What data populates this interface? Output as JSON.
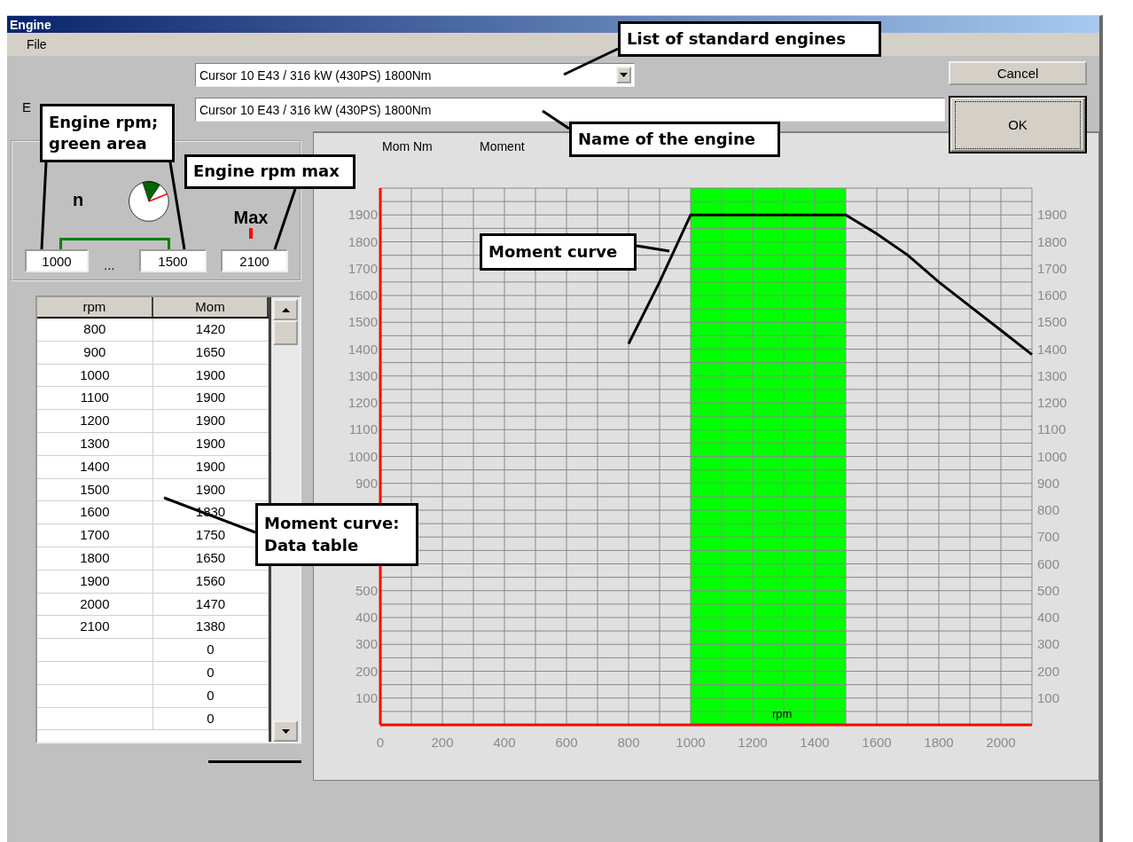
{
  "window": {
    "title": "Engine"
  },
  "menu": [
    {
      "label": "File"
    }
  ],
  "engine_list": {
    "value": "Cursor 10 E43 / 316 kW (430PS) 1800Nm"
  },
  "engine_label": "E",
  "engine_name": {
    "value": "Cursor 10 E43 / 316 kW (430PS) 1800Nm"
  },
  "buttons": [
    {
      "label": "Cancel",
      "focused": false
    },
    {
      "label": "OK",
      "focused": true
    }
  ],
  "rpm_range": {
    "label": "n",
    "from": "1000",
    "separator": "...",
    "to": "1500",
    "max_label": "Max",
    "max": "2100"
  },
  "table": {
    "columns": [
      "rpm",
      "Mom"
    ],
    "rows": [
      [
        "800",
        "1420"
      ],
      [
        "900",
        "1650"
      ],
      [
        "1000",
        "1900"
      ],
      [
        "1100",
        "1900"
      ],
      [
        "1200",
        "1900"
      ],
      [
        "1300",
        "1900"
      ],
      [
        "1400",
        "1900"
      ],
      [
        "1500",
        "1900"
      ],
      [
        "1600",
        "1830"
      ],
      [
        "1700",
        "1750"
      ],
      [
        "1800",
        "1650"
      ],
      [
        "1900",
        "1560"
      ],
      [
        "2000",
        "1470"
      ],
      [
        "2100",
        "1380"
      ],
      [
        "",
        "0"
      ],
      [
        "",
        "0"
      ],
      [
        "",
        "0"
      ],
      [
        "",
        "0"
      ]
    ]
  },
  "chart": {
    "left_axis_labels_upper": [
      "1900",
      "1800",
      "1700",
      "1600",
      "1500",
      "1400",
      "1300",
      "1200",
      "1100",
      "1000",
      "900"
    ],
    "left_axis_labels_lower": [
      "500",
      "400",
      "300",
      "200",
      "100"
    ],
    "chart_data": {
      "type": "line",
      "title": "Moment",
      "ylabel": "Mom Nm",
      "xlabel": "rpm",
      "grid": true,
      "x": [
        800,
        900,
        1000,
        1100,
        1200,
        1300,
        1400,
        1500,
        1600,
        1700,
        1800,
        1900,
        2000,
        2100
      ],
      "series": [
        {
          "color": "#000000",
          "values": [
            1420,
            1650,
            1900,
            1900,
            1900,
            1900,
            1900,
            1900,
            1830,
            1750,
            1650,
            1560,
            1470,
            1380
          ]
        }
      ],
      "bands": [
        {
          "axis": "x",
          "from": 1000,
          "to": 1500,
          "color": "#00ff00"
        }
      ],
      "xlim": [
        0,
        2100
      ],
      "ylim": [
        0,
        2000
      ],
      "xticks": [
        0,
        200,
        400,
        600,
        800,
        1000,
        1200,
        1400,
        1600,
        1800,
        2000
      ],
      "yticks": [
        100,
        200,
        300,
        400,
        500,
        600,
        700,
        800,
        900,
        1000,
        1100,
        1200,
        1300,
        1400,
        1500,
        1600,
        1700,
        1800,
        1900
      ]
    }
  },
  "callouts": [
    {
      "text": "List of standard engines"
    },
    {
      "text": "Engine rpm; green area"
    },
    {
      "text": "Name of the engine"
    },
    {
      "text": "Engine rpm max"
    },
    {
      "text": "Moment curve"
    },
    {
      "text": "Moment curve: Data table"
    }
  ]
}
